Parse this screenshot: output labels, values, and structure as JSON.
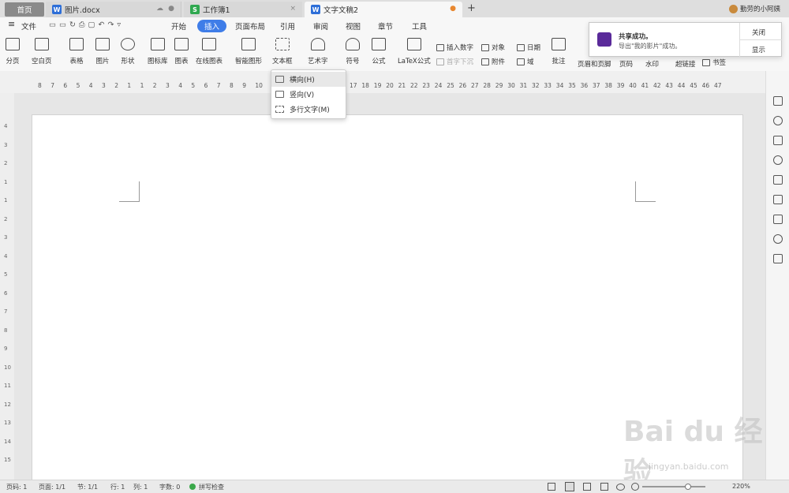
{
  "tabs": {
    "home": "首页",
    "tab1": "图片.docx",
    "tab2": "工作簿1",
    "tab3": "文字文稿2",
    "new_tab": "+",
    "user": "勤劳的小阿姨"
  },
  "menu": {
    "file": "文件",
    "items": [
      "开始",
      "插入",
      "页面布局",
      "引用",
      "审阅",
      "视图",
      "章节",
      "工具"
    ]
  },
  "ribbon": {
    "big": [
      "分页",
      "空白页",
      "表格",
      "图片",
      "形状",
      "图标库",
      "图表",
      "在线图表",
      "智能图形",
      "文本框",
      "艺术字",
      "符号",
      "公式",
      "LaTeX公式",
      "批注",
      "页眉和页脚",
      "页码",
      "水印",
      "超链接"
    ],
    "small": [
      "插入数字",
      "对象",
      "日期",
      "首字下沉",
      "附件",
      "域",
      "书签"
    ]
  },
  "textbox_menu": [
    "横向(H)",
    "竖向(V)",
    "多行文字(M)"
  ],
  "ruler_ticks": [
    "8",
    "7",
    "6",
    "5",
    "4",
    "3",
    "2",
    "1",
    "1",
    "2",
    "3",
    "4",
    "5",
    "6",
    "7",
    "8",
    "9",
    "10",
    "17",
    "18",
    "19",
    "20",
    "21",
    "22",
    "23",
    "24",
    "25",
    "26",
    "27",
    "28",
    "29",
    "30",
    "31",
    "32",
    "33",
    "34",
    "35",
    "36",
    "37",
    "38",
    "39",
    "40",
    "41",
    "42",
    "43",
    "44",
    "45",
    "46",
    "47"
  ],
  "vruler_ticks": [
    "4",
    "3",
    "2",
    "1",
    "1",
    "2",
    "3",
    "4",
    "5",
    "6",
    "7",
    "8",
    "9",
    "10",
    "11",
    "12",
    "13",
    "14",
    "15"
  ],
  "notification": {
    "title": "共享成功。",
    "message": "导出\"我的影片\"成功。",
    "close": "关闭",
    "show": "显示"
  },
  "status": {
    "page_num": "页码: 1",
    "pages": "页面: 1/1",
    "section": "节: 1/1",
    "row": "行: 1",
    "col": "列: 1",
    "words": "字数: 0",
    "spell": "拼写检查",
    "zoom": "220%"
  },
  "watermark": {
    "brand": "Bai du 经验",
    "url": "jingyan.baidu.com"
  },
  "colors": {
    "accent": "#3f7de8",
    "doc_blue": "#2e6fd8",
    "sheet_green": "#2fa84f",
    "notify_icon": "#5a2a9a"
  }
}
